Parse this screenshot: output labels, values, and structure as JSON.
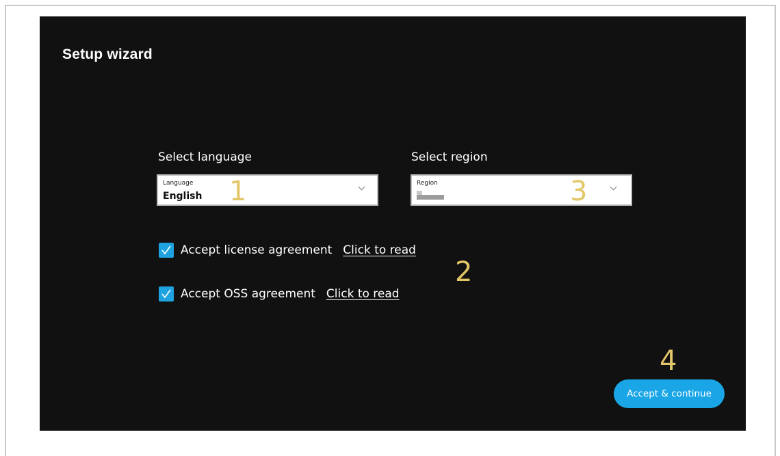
{
  "window": {
    "title": "Setup wizard"
  },
  "language": {
    "section_label": "Select language",
    "field_label": "Language",
    "value": "English",
    "marker": "1"
  },
  "region": {
    "section_label": "Select region",
    "field_label": "Region",
    "value_redacted": true,
    "marker": "3"
  },
  "agreements": {
    "marker": "2",
    "items": [
      {
        "label": "Accept license agreement",
        "link": "Click to read",
        "checked": true
      },
      {
        "label": "Accept OSS agreement",
        "link": "Click to read",
        "checked": true
      }
    ]
  },
  "footer": {
    "marker": "4",
    "accept_label": "Accept & continue"
  },
  "colors": {
    "background": "#111111",
    "accent": "#1aa6e6",
    "marker": "#e3c667"
  }
}
